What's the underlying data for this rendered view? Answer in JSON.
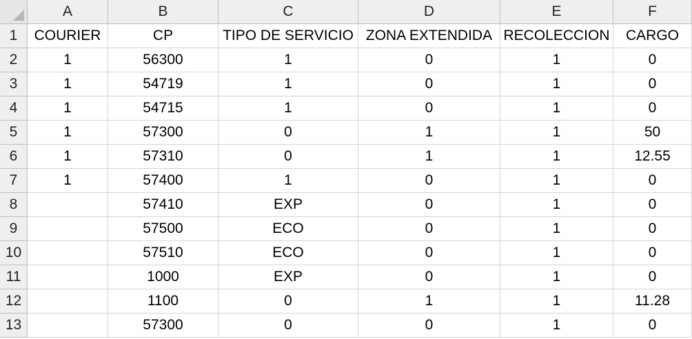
{
  "sheet": {
    "columns": [
      "A",
      "B",
      "C",
      "D",
      "E",
      "F"
    ],
    "row_numbers": [
      "1",
      "2",
      "3",
      "4",
      "5",
      "6",
      "7",
      "8",
      "9",
      "10",
      "11",
      "12",
      "13"
    ],
    "rows": [
      [
        "COURIER",
        "CP",
        "TIPO DE SERVICIO",
        "ZONA EXTENDIDA",
        "RECOLECCION",
        "CARGO"
      ],
      [
        "1",
        "56300",
        "1",
        "0",
        "1",
        "0"
      ],
      [
        "1",
        "54719",
        "1",
        "0",
        "1",
        "0"
      ],
      [
        "1",
        "54715",
        "1",
        "0",
        "1",
        "0"
      ],
      [
        "1",
        "57300",
        "0",
        "1",
        "1",
        "50"
      ],
      [
        "1",
        "57310",
        "0",
        "1",
        "1",
        "12.55"
      ],
      [
        "1",
        "57400",
        "1",
        "0",
        "1",
        "0"
      ],
      [
        "",
        "57410",
        "EXP",
        "0",
        "1",
        "0"
      ],
      [
        "",
        "57500",
        "ECO",
        "0",
        "1",
        "0"
      ],
      [
        "",
        "57510",
        "ECO",
        "0",
        "1",
        "0"
      ],
      [
        "",
        "1000",
        "EXP",
        "0",
        "1",
        "0"
      ],
      [
        "",
        "1100",
        "0",
        "1",
        "1",
        "11.28"
      ],
      [
        "",
        "57300",
        "0",
        "0",
        "1",
        "0"
      ]
    ]
  }
}
